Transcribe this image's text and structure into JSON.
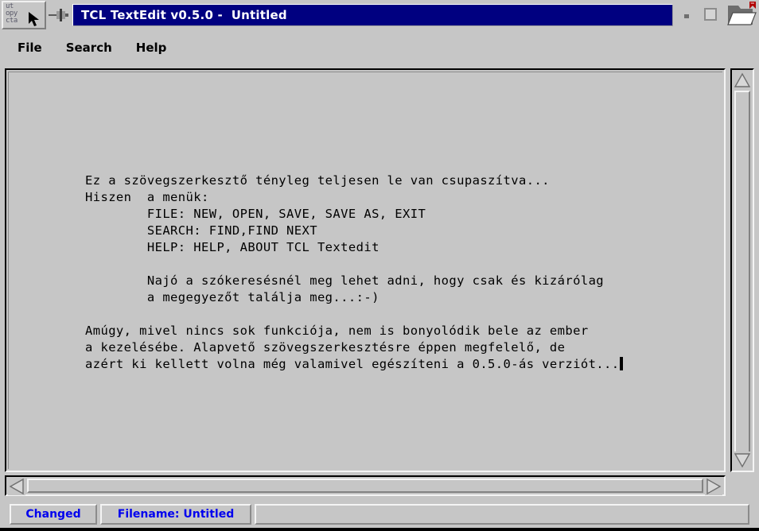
{
  "window": {
    "title": "TCL TextEdit v0.5.0 -  Untitled",
    "menu_button_glyph": "ut\nopy\ncta",
    "icons": {
      "window_menu": "window-menu-icon",
      "pin": "pin-icon",
      "mouse_pointer": "mouse-pointer-icon",
      "minimize": "minimize-icon",
      "maximize": "maximize-icon",
      "folder": "open-folder-icon"
    },
    "colors": {
      "titlebar_bg": "#000080",
      "titlebar_fg": "#ffffff",
      "face": "#c6c6c6",
      "status_fg": "#0000ee",
      "folder_accent": "#b00000"
    }
  },
  "menubar": {
    "items": [
      {
        "label": "File"
      },
      {
        "label": "Search"
      },
      {
        "label": "Help"
      }
    ]
  },
  "editor": {
    "lines": [
      "Ez a szövegszerkesztő tényleg teljesen le van csupaszítva...",
      "Hiszen  a menük:",
      "        FILE: NEW, OPEN, SAVE, SAVE AS, EXIT",
      "        SEARCH: FIND,FIND NEXT",
      "        HELP: HELP, ABOUT TCL Textedit",
      "",
      "        Najó a szókeresésnél meg lehet adni, hogy csak és kizárólag",
      "        a megegyezőt találja meg...:-)",
      "",
      "Amúgy, mivel nincs sok funkciója, nem is bonyolódik bele az ember",
      "a kezelésébe. Alapvető szövegszerkesztésre éppen megfelelő, de",
      "azért ki kellett volna még valamivel egészíteni a 0.5.0-ás verziót..."
    ],
    "caret_visible": true
  },
  "scrollbars": {
    "vertical": {
      "up_arrow": "scroll-up-arrow-icon",
      "down_arrow": "scroll-down-arrow-icon",
      "thumb_position_percent": 0
    },
    "horizontal": {
      "left_arrow": "scroll-left-arrow-icon",
      "right_arrow": "scroll-right-arrow-icon",
      "thumb_position_percent": 0
    }
  },
  "statusbar": {
    "changed": "Changed",
    "filename": "Filename: Untitled",
    "extra": ""
  }
}
